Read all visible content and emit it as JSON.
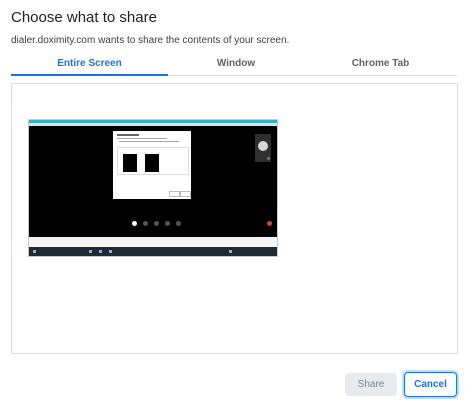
{
  "dialog": {
    "title": "Choose what to share",
    "subtitle": "dialer.doximity.com wants to share the contents of your screen."
  },
  "tabs": [
    {
      "label": "Entire Screen",
      "active": true
    },
    {
      "label": "Window",
      "active": false
    },
    {
      "label": "Chrome Tab",
      "active": false
    }
  ],
  "buttons": {
    "share": "Share",
    "cancel": "Cancel"
  },
  "colors": {
    "accent": "#1a73e8",
    "disabled_bg": "#e8eaed"
  }
}
